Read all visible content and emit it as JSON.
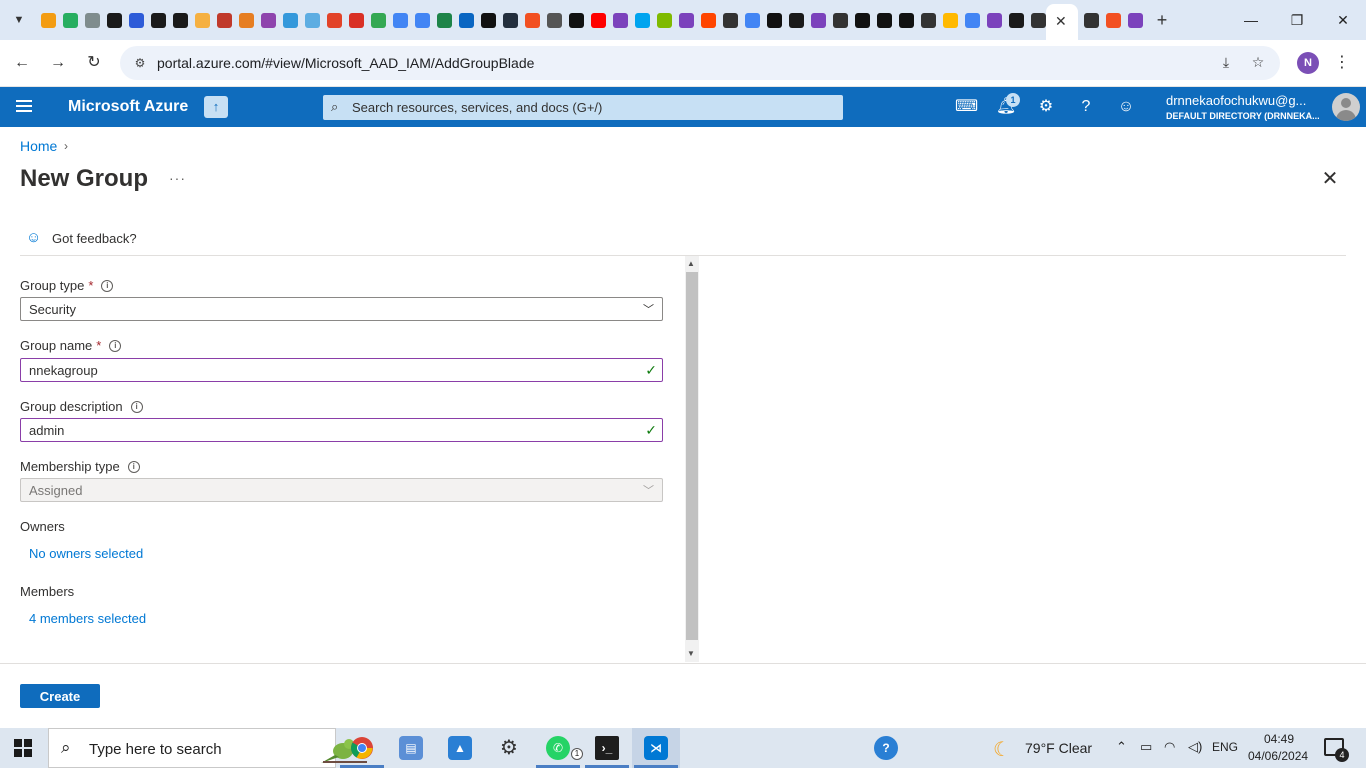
{
  "browser": {
    "url": "portal.azure.com/#view/Microsoft_AAD_IAM/AddGroupBlade",
    "profile_initial": "N",
    "tab_icons": [
      {
        "icon": "cube-icon",
        "color": "#f39c12"
      },
      {
        "icon": "azure-devops-icon",
        "color": "#27ae60"
      },
      {
        "icon": "dots-icon",
        "color": "#7f8c8d"
      },
      {
        "icon": "hashicorp-icon",
        "color": "#1a1a1a"
      },
      {
        "icon": "azure-icon",
        "color": "#2d5bd8"
      },
      {
        "icon": "hashicorp-icon",
        "color": "#1a1a1a"
      },
      {
        "icon": "hashicorp-icon",
        "color": "#1a1a1a"
      },
      {
        "icon": "note-icon",
        "color": "#f5b041"
      },
      {
        "icon": "redhat-icon",
        "color": "#c0392b"
      },
      {
        "icon": "cloud-icon",
        "color": "#e67e22"
      },
      {
        "icon": "cube-outline-icon",
        "color": "#8e44ad"
      },
      {
        "icon": "cube-outline-icon",
        "color": "#3498db"
      },
      {
        "icon": "network-icon",
        "color": "#5dade2"
      },
      {
        "icon": "gitlab-icon",
        "color": "#e24329"
      },
      {
        "icon": "gmail-icon",
        "color": "#d93025"
      },
      {
        "icon": "drive-icon",
        "color": "#34a853"
      },
      {
        "icon": "docs-icon",
        "color": "#4285f4"
      },
      {
        "icon": "google-icon",
        "color": "#4285f4"
      },
      {
        "icon": "link-icon",
        "color": "#1e8449"
      },
      {
        "icon": "linkedin-icon",
        "color": "#0a66c2"
      },
      {
        "icon": "chart-icon",
        "color": "#111111"
      },
      {
        "icon": "aws-icon",
        "color": "#232f3e"
      },
      {
        "icon": "microsoft-icon",
        "color": "#f25022"
      },
      {
        "icon": "globe-icon",
        "color": "#555555"
      },
      {
        "icon": "github-icon",
        "color": "#111111"
      },
      {
        "icon": "youtube-icon",
        "color": "#ff0000"
      },
      {
        "icon": "terraform-icon",
        "color": "#7b42bc"
      },
      {
        "icon": "microsoft-icon",
        "color": "#00a4ef"
      },
      {
        "icon": "microsoft-icon",
        "color": "#7fba00"
      },
      {
        "icon": "terraform-icon",
        "color": "#7b42bc"
      },
      {
        "icon": "reddit-icon",
        "color": "#ff4500"
      },
      {
        "icon": "wikipedia-icon",
        "color": "#333333"
      },
      {
        "icon": "google-icon",
        "color": "#4285f4"
      },
      {
        "icon": "github-icon",
        "color": "#111111"
      },
      {
        "icon": "hashicorp-icon",
        "color": "#1a1a1a"
      },
      {
        "icon": "terraform-icon",
        "color": "#7b42bc"
      },
      {
        "icon": "openai-icon",
        "color": "#333333"
      },
      {
        "icon": "graduation-icon",
        "color": "#111111"
      },
      {
        "icon": "x-icon",
        "color": "#111111"
      },
      {
        "icon": "graduation-icon",
        "color": "#111111"
      },
      {
        "icon": "openai-icon",
        "color": "#333333"
      },
      {
        "icon": "microsoft-icon",
        "color": "#ffb900"
      },
      {
        "icon": "google-icon",
        "color": "#4285f4"
      },
      {
        "icon": "terraform-icon",
        "color": "#7b42bc"
      },
      {
        "icon": "hashicorp-icon",
        "color": "#1a1a1a"
      },
      {
        "icon": "openai-icon",
        "color": "#333333"
      },
      {
        "icon": "google-icon",
        "color": "#4285f4"
      }
    ],
    "tab_icons_after": [
      {
        "icon": "openai-icon",
        "color": "#333333"
      },
      {
        "icon": "microsoft-icon",
        "color": "#f25022"
      },
      {
        "icon": "terraform-icon",
        "color": "#7b42bc"
      }
    ]
  },
  "azure": {
    "brand": "Microsoft Azure",
    "search_placeholder": "Search resources, services, and docs (G+/)",
    "notification_count": "1",
    "account_name": "drnnekaofochukwu@g...",
    "account_directory": "DEFAULT DIRECTORY (DRNNEKA..."
  },
  "page": {
    "breadcrumb_home": "Home",
    "title": "New Group",
    "feedback_label": "Got feedback?"
  },
  "form": {
    "group_type_label": "Group type",
    "group_type_value": "Security",
    "group_name_label": "Group name",
    "group_name_value": "nnekagroup",
    "group_description_label": "Group description",
    "group_description_value": "admin",
    "membership_type_label": "Membership type",
    "membership_type_value": "Assigned",
    "owners_label": "Owners",
    "owners_link": "No owners selected",
    "members_label": "Members",
    "members_link": "4 members selected",
    "create_label": "Create"
  },
  "taskbar": {
    "search_text": "Type here to search",
    "whatsapp_badge": "1",
    "weather": "79°F  Clear",
    "language": "ENG",
    "time": "04:49",
    "date": "04/06/2024",
    "notification_count": "4"
  }
}
